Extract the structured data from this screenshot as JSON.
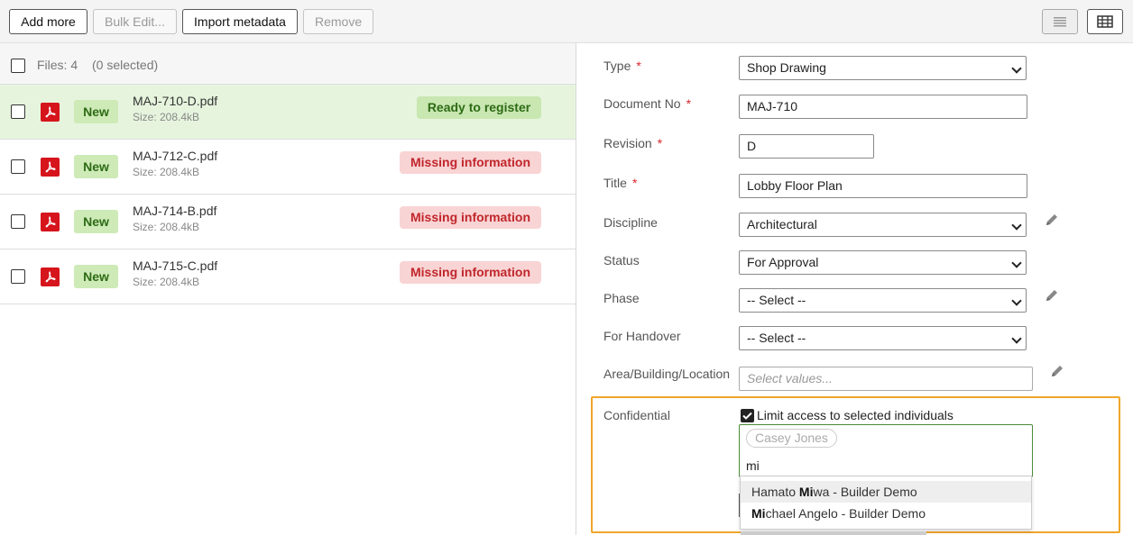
{
  "toolbar": {
    "add_more": "Add more",
    "bulk_edit": "Bulk Edit...",
    "import_metadata": "Import metadata",
    "remove": "Remove",
    "list_view_icon": "list-icon",
    "table_view_icon": "table-icon"
  },
  "files": {
    "count_label": "Files: 4",
    "selected_label": "(0 selected)",
    "rows": [
      {
        "badge": "New",
        "name": "MAJ-710-D.pdf",
        "size": "Size: 208.4kB",
        "status": "Ready to register",
        "status_kind": "ready"
      },
      {
        "badge": "New",
        "name": "MAJ-712-C.pdf",
        "size": "Size: 208.4kB",
        "status": "Missing information",
        "status_kind": "missing"
      },
      {
        "badge": "New",
        "name": "MAJ-714-B.pdf",
        "size": "Size: 208.4kB",
        "status": "Missing information",
        "status_kind": "missing"
      },
      {
        "badge": "New",
        "name": "MAJ-715-C.pdf",
        "size": "Size: 208.4kB",
        "status": "Missing information",
        "status_kind": "missing"
      }
    ]
  },
  "form": {
    "type": {
      "label": "Type",
      "required": "*",
      "value": "Shop Drawing"
    },
    "document_no": {
      "label": "Document No",
      "required": "*",
      "value": "MAJ-710"
    },
    "revision": {
      "label": "Revision",
      "required": "*",
      "value": "D"
    },
    "title": {
      "label": "Title",
      "required": "*",
      "value": "Lobby Floor Plan"
    },
    "discipline": {
      "label": "Discipline",
      "value": "Architectural"
    },
    "status": {
      "label": "Status",
      "value": "For Approval"
    },
    "phase": {
      "label": "Phase",
      "value": "-- Select --"
    },
    "for_handover": {
      "label": "For Handover",
      "value": "-- Select --"
    },
    "area": {
      "label": "Area/Building/Location",
      "placeholder": "Select values..."
    },
    "confidential": {
      "label": "Confidential",
      "checkbox_label": "Limit access to selected individuals",
      "checked": true,
      "chip": "Casey Jones",
      "typed": "mi",
      "suggestions": [
        {
          "pre": "Hamato ",
          "match": "Mi",
          "post": "wa - Builder Demo"
        },
        {
          "pre": "",
          "match": "Mi",
          "post": "chael Angelo - Builder Demo"
        }
      ]
    }
  },
  "colors": {
    "ready_bg": "#c8e7b1",
    "missing_bg": "#f9d4d4",
    "highlight_border": "#f0a52a",
    "pdf_red": "#d6141c"
  }
}
